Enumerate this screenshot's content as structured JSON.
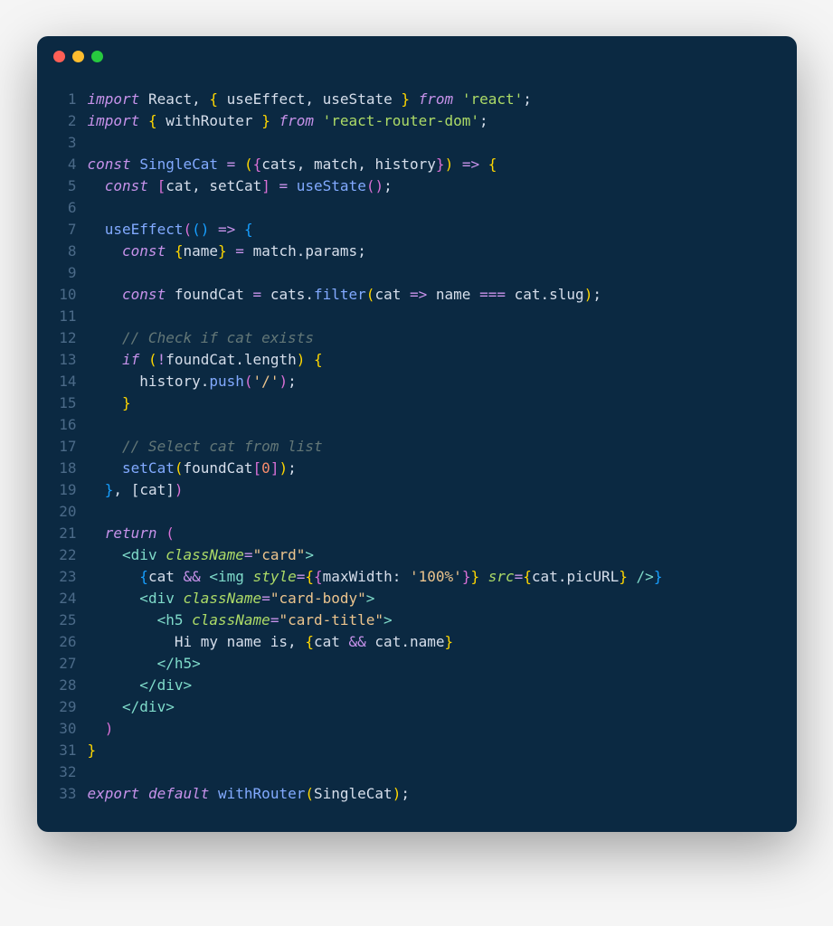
{
  "window": {
    "traffic_dots": [
      "close",
      "minimize",
      "zoom"
    ]
  },
  "code": {
    "lines": [
      {
        "n": 1,
        "html": "<span class='kw'>import</span> <span class='var'>React</span><span class='punc'>,</span> <span class='brace'>{</span> <span class='var'>useEffect</span><span class='punc'>,</span> <span class='var'>useState</span> <span class='brace'>}</span> <span class='kw'>from</span> <span class='strg'>'react'</span><span class='punc'>;</span>"
      },
      {
        "n": 2,
        "html": "<span class='kw'>import</span> <span class='brace'>{</span> <span class='var'>withRouter</span> <span class='brace'>}</span> <span class='kw'>from</span> <span class='strg'>'react-router-dom'</span><span class='punc'>;</span>"
      },
      {
        "n": 3,
        "html": ""
      },
      {
        "n": 4,
        "html": "<span class='kw'>const</span> <span class='fn'>SingleCat</span> <span class='op'>=</span> <span class='paren'>(</span><span class='brace2'>{</span><span class='var'>cats</span><span class='punc'>,</span> <span class='var'>match</span><span class='punc'>,</span> <span class='var'>history</span><span class='brace2'>}</span><span class='paren'>)</span> <span class='op'>=&gt;</span> <span class='brace'>{</span>"
      },
      {
        "n": 5,
        "html": "  <span class='kw'>const</span> <span class='brack2'>[</span><span class='var'>cat</span><span class='punc'>,</span> <span class='var'>setCat</span><span class='brack2'>]</span> <span class='op'>=</span> <span class='fncall'>useState</span><span class='paren2'>(</span><span class='paren2'>)</span><span class='punc'>;</span>"
      },
      {
        "n": 6,
        "html": ""
      },
      {
        "n": 7,
        "html": "  <span class='fncall'>useEffect</span><span class='paren2'>(</span><span class='paren3'>(</span><span class='paren3'>)</span> <span class='op'>=&gt;</span> <span class='brace3'>{</span>"
      },
      {
        "n": 8,
        "html": "    <span class='kw'>const</span> <span class='brace'>{</span><span class='var'>name</span><span class='brace'>}</span> <span class='op'>=</span> <span class='var'>match</span><span class='punc'>.</span><span class='var'>params</span><span class='punc'>;</span>"
      },
      {
        "n": 9,
        "html": ""
      },
      {
        "n": 10,
        "html": "    <span class='kw'>const</span> <span class='var'>foundCat</span> <span class='op'>=</span> <span class='var'>cats</span><span class='punc'>.</span><span class='fncall'>filter</span><span class='paren'>(</span><span class='var'>cat</span> <span class='op'>=&gt;</span> <span class='var'>name</span> <span class='op'>===</span> <span class='var'>cat</span><span class='punc'>.</span><span class='var'>slug</span><span class='paren'>)</span><span class='punc'>;</span>"
      },
      {
        "n": 11,
        "html": ""
      },
      {
        "n": 12,
        "html": "    <span class='cmt'>// Check if cat exists</span>"
      },
      {
        "n": 13,
        "html": "    <span class='kw'>if</span> <span class='paren'>(</span><span class='op'>!</span><span class='var'>foundCat</span><span class='punc'>.</span><span class='var'>length</span><span class='paren'>)</span> <span class='brace'>{</span>"
      },
      {
        "n": 14,
        "html": "      <span class='var'>history</span><span class='punc'>.</span><span class='fncall'>push</span><span class='paren2'>(</span><span class='str'>'/'</span><span class='paren2'>)</span><span class='punc'>;</span>"
      },
      {
        "n": 15,
        "html": "    <span class='brace'>}</span>"
      },
      {
        "n": 16,
        "html": ""
      },
      {
        "n": 17,
        "html": "    <span class='cmt'>// Select cat from list</span>"
      },
      {
        "n": 18,
        "html": "    <span class='fncall'>setCat</span><span class='paren'>(</span><span class='var'>foundCat</span><span class='brack2'>[</span><span class='num'>0</span><span class='brack2'>]</span><span class='paren'>)</span><span class='punc'>;</span>"
      },
      {
        "n": 19,
        "html": "  <span class='brace3'>}</span><span class='punc'>,</span> <span class='brack3'>[</span><span class='var'>cat</span><span class='brack3'>]</span><span class='paren2'>)</span>"
      },
      {
        "n": 20,
        "html": ""
      },
      {
        "n": 21,
        "html": "  <span class='kw'>return</span> <span class='paren2'>(</span>"
      },
      {
        "n": 22,
        "html": "    <span class='taga'>&lt;</span><span class='tag'>div</span> <span class='attr'>className</span><span class='op'>=</span><span class='str'>\"card\"</span><span class='taga'>&gt;</span>"
      },
      {
        "n": 23,
        "html": "      <span class='brace3'>{</span><span class='var'>cat</span> <span class='op'>&amp;&amp;</span> <span class='taga'>&lt;</span><span class='tag'>img</span> <span class='attr'>style</span><span class='op'>=</span><span class='brace'>{</span><span class='brace2'>{</span><span class='var'>maxWidth</span><span class='punc'>:</span> <span class='str'>'100%'</span><span class='brace2'>}</span><span class='brace'>}</span> <span class='attr'>src</span><span class='op'>=</span><span class='brace'>{</span><span class='var'>cat</span><span class='punc'>.</span><span class='var'>picURL</span><span class='brace'>}</span> <span class='taga'>/&gt;</span><span class='brace3'>}</span>"
      },
      {
        "n": 24,
        "html": "      <span class='taga'>&lt;</span><span class='tag'>div</span> <span class='attr'>className</span><span class='op'>=</span><span class='str'>\"card-body\"</span><span class='taga'>&gt;</span>"
      },
      {
        "n": 25,
        "html": "        <span class='taga'>&lt;</span><span class='tag'>h5</span> <span class='attr'>className</span><span class='op'>=</span><span class='str'>\"card-title\"</span><span class='taga'>&gt;</span>"
      },
      {
        "n": 26,
        "html": "          <span class='var'>Hi my name is,</span> <span class='brace'>{</span><span class='var'>cat</span> <span class='op'>&amp;&amp;</span> <span class='var'>cat</span><span class='punc'>.</span><span class='var'>name</span><span class='brace'>}</span>"
      },
      {
        "n": 27,
        "html": "        <span class='taga'>&lt;/</span><span class='tag'>h5</span><span class='taga'>&gt;</span>"
      },
      {
        "n": 28,
        "html": "      <span class='taga'>&lt;/</span><span class='tag'>div</span><span class='taga'>&gt;</span>"
      },
      {
        "n": 29,
        "html": "    <span class='taga'>&lt;/</span><span class='tag'>div</span><span class='taga'>&gt;</span>"
      },
      {
        "n": 30,
        "html": "  <span class='paren2'>)</span>"
      },
      {
        "n": 31,
        "html": "<span class='brace'>}</span>"
      },
      {
        "n": 32,
        "html": ""
      },
      {
        "n": 33,
        "html": "<span class='kw'>export</span> <span class='kw'>default</span> <span class='fncall'>withRouter</span><span class='paren'>(</span><span class='var'>SingleCat</span><span class='paren'>)</span><span class='punc'>;</span>"
      }
    ]
  }
}
